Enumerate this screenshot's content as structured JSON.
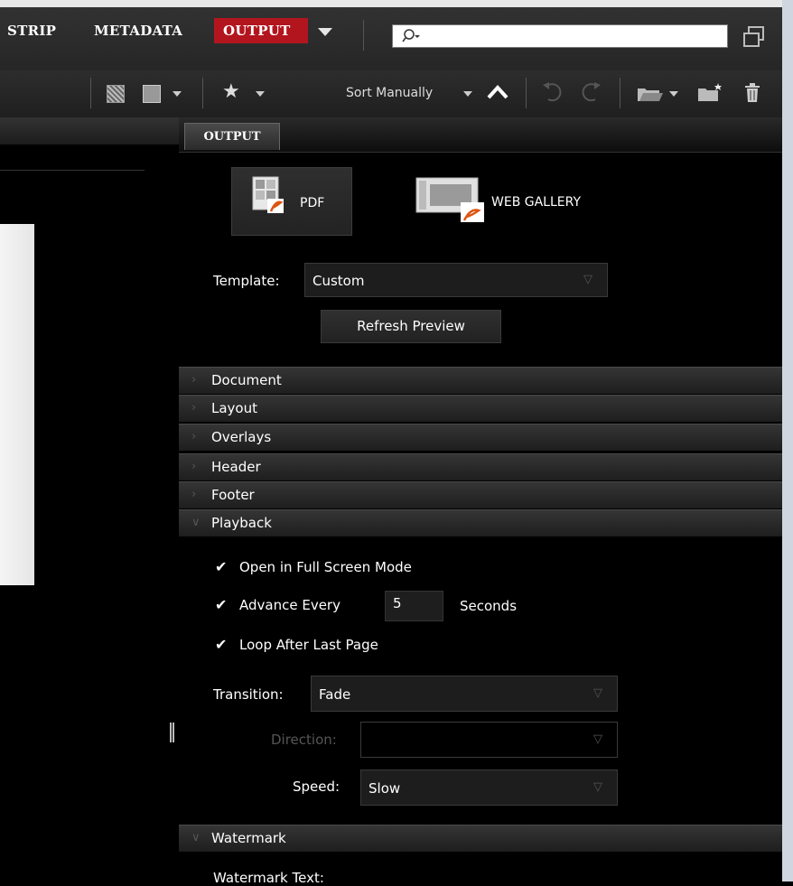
{
  "workspace": {
    "tabs": [
      "STRIP",
      "METADATA",
      "OUTPUT"
    ],
    "search_placeholder": ""
  },
  "toolbar": {
    "sort_label": "Sort Manually"
  },
  "panel": {
    "tab_label": "OUTPUT",
    "pdf_label": "PDF",
    "web_gallery_label": "WEB GALLERY",
    "template_label": "Template:",
    "template_value": "Custom",
    "refresh_label": "Refresh Preview"
  },
  "sections": [
    "Document",
    "Layout",
    "Overlays",
    "Header",
    "Footer",
    "Playback"
  ],
  "playback": {
    "full_screen_label": "Open in Full Screen Mode",
    "full_screen_checked": true,
    "advance_label": "Advance Every",
    "advance_checked": true,
    "advance_value": "5",
    "seconds_label": "Seconds",
    "loop_label": "Loop After Last Page",
    "loop_checked": true,
    "transition_label": "Transition:",
    "transition_value": "Fade",
    "direction_label": "Direction:",
    "direction_value": "",
    "speed_label": "Speed:",
    "speed_value": "Slow"
  },
  "watermark": {
    "section_title": "Watermark",
    "text_label": "Watermark Text:"
  },
  "colors": {
    "accent_red": "#b3151e",
    "panel_bg": "#000000"
  }
}
